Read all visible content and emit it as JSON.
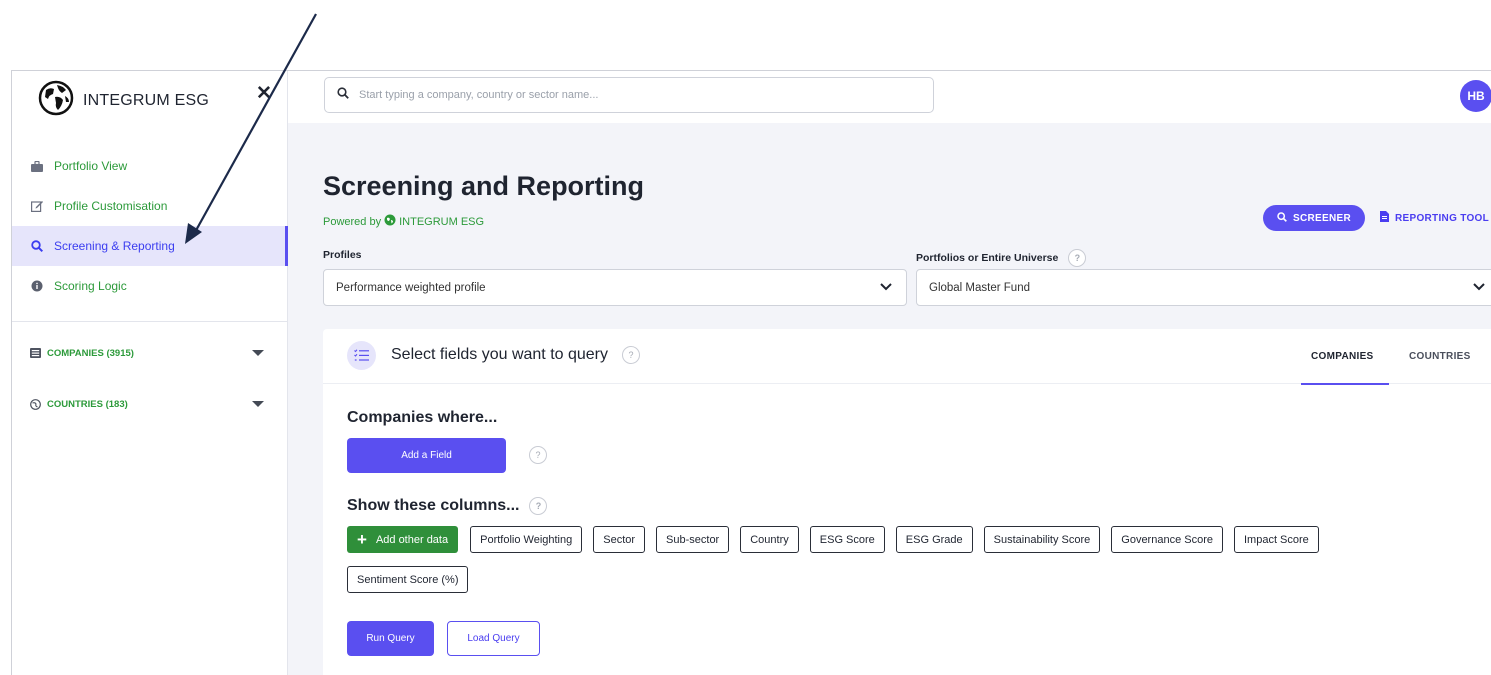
{
  "brand": {
    "name": "INTEGRUM ESG"
  },
  "sidebar": {
    "items": [
      {
        "label": "Portfolio View",
        "icon": "briefcase-icon"
      },
      {
        "label": "Profile Customisation",
        "icon": "edit-icon"
      },
      {
        "label": "Screening & Reporting",
        "icon": "search-icon",
        "active": true
      },
      {
        "label": "Scoring Logic",
        "icon": "info-icon"
      }
    ],
    "groups": [
      {
        "label": "COMPANIES (3915)",
        "icon": "building-icon"
      },
      {
        "label": "COUNTRIES (183)",
        "icon": "globe-icon"
      }
    ]
  },
  "topbar": {
    "search_placeholder": "Start typing a company, country or sector name...",
    "avatar_initials": "HB"
  },
  "page": {
    "title": "Screening and Reporting",
    "powered_by_prefix": "Powered by",
    "powered_by_brand": "INTEGRUM ESG",
    "screener_label": "SCREENER",
    "reporting_label": "REPORTING TOOL"
  },
  "filters": {
    "profiles_label": "Profiles",
    "profiles_value": "Performance weighted profile",
    "portfolios_label": "Portfolios or Entire Universe",
    "portfolios_value": "Global Master Fund",
    "help_glyph": "?"
  },
  "query": {
    "title": "Select fields you want to query",
    "tabs": [
      "COMPANIES",
      "COUNTRIES"
    ],
    "companies_where": "Companies where...",
    "add_field_label": "Add a Field",
    "show_columns": "Show these columns...",
    "add_other_data": "Add other data",
    "columns": [
      "Portfolio Weighting",
      "Sector",
      "Sub-sector",
      "Country",
      "ESG Score",
      "ESG Grade",
      "Sustainability Score",
      "Governance Score",
      "Impact Score",
      "Sentiment Score (%)"
    ],
    "run_label": "Run Query",
    "load_label": "Load Query"
  },
  "colors": {
    "accent": "#5a4ff0",
    "green": "#2c9a3a",
    "add_data_green": "#2f8f3a",
    "arrow": "#1c2a4a"
  }
}
